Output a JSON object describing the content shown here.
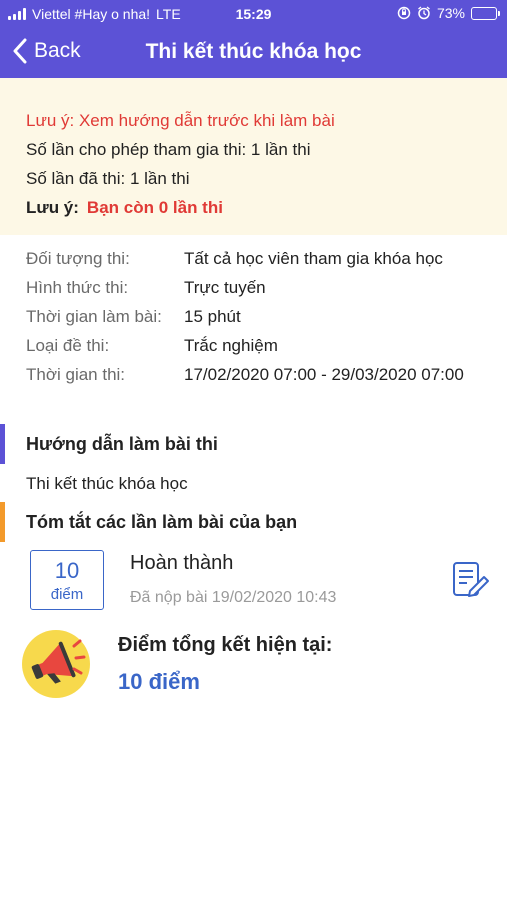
{
  "status_bar": {
    "carrier": "Viettel #Hay o nha!",
    "network": "LTE",
    "time": "15:29",
    "battery": "73%",
    "battery_level": 0.73
  },
  "nav": {
    "back_label": "Back",
    "title": "Thi kết thúc khóa học"
  },
  "notice": {
    "guide_warning": "Lưu ý: Xem hướng dẫn trước khi làm bài",
    "allowed_attempts": "Số lần cho phép tham gia thi: 1 lần thi",
    "taken_attempts": "Số lần đã thi: 1 lần thi",
    "note_label": "Lưu ý:",
    "remaining": "Bạn còn 0 lần thi"
  },
  "info": {
    "rows": [
      {
        "label": "Đối tượng thi:",
        "value": "Tất cả học viên tham gia khóa học"
      },
      {
        "label": "Hình thức thi:",
        "value": "Trực tuyến"
      },
      {
        "label": "Thời gian làm bài:",
        "value": "15 phút"
      },
      {
        "label": "Loại đề thi:",
        "value": "Trắc nghiệm"
      },
      {
        "label": "Thời gian thi:",
        "value": "17/02/2020 07:00 - 29/03/2020 07:00"
      }
    ]
  },
  "guide": {
    "title": "Hướng dẫn làm bài thi",
    "text": "Thi kết thúc khóa học",
    "accent_color": "#5c52d6"
  },
  "summary": {
    "title": "Tóm tắt các lần làm bài của bạn",
    "accent_color": "#f39a2b",
    "attempt": {
      "score": "10",
      "score_unit": "điểm",
      "status": "Hoàn thành",
      "submitted": "Đã nộp bài 19/02/2020 10:43",
      "action_icon": "edit-document-icon"
    }
  },
  "final": {
    "label": "Điểm tổng kết hiện tại:",
    "value": "10 điểm",
    "icon": "megaphone-icon"
  },
  "colors": {
    "header": "#5c52d6",
    "warning": "#e03a36",
    "score": "#3a66c8",
    "notice_bg": "#fdf8e6"
  }
}
